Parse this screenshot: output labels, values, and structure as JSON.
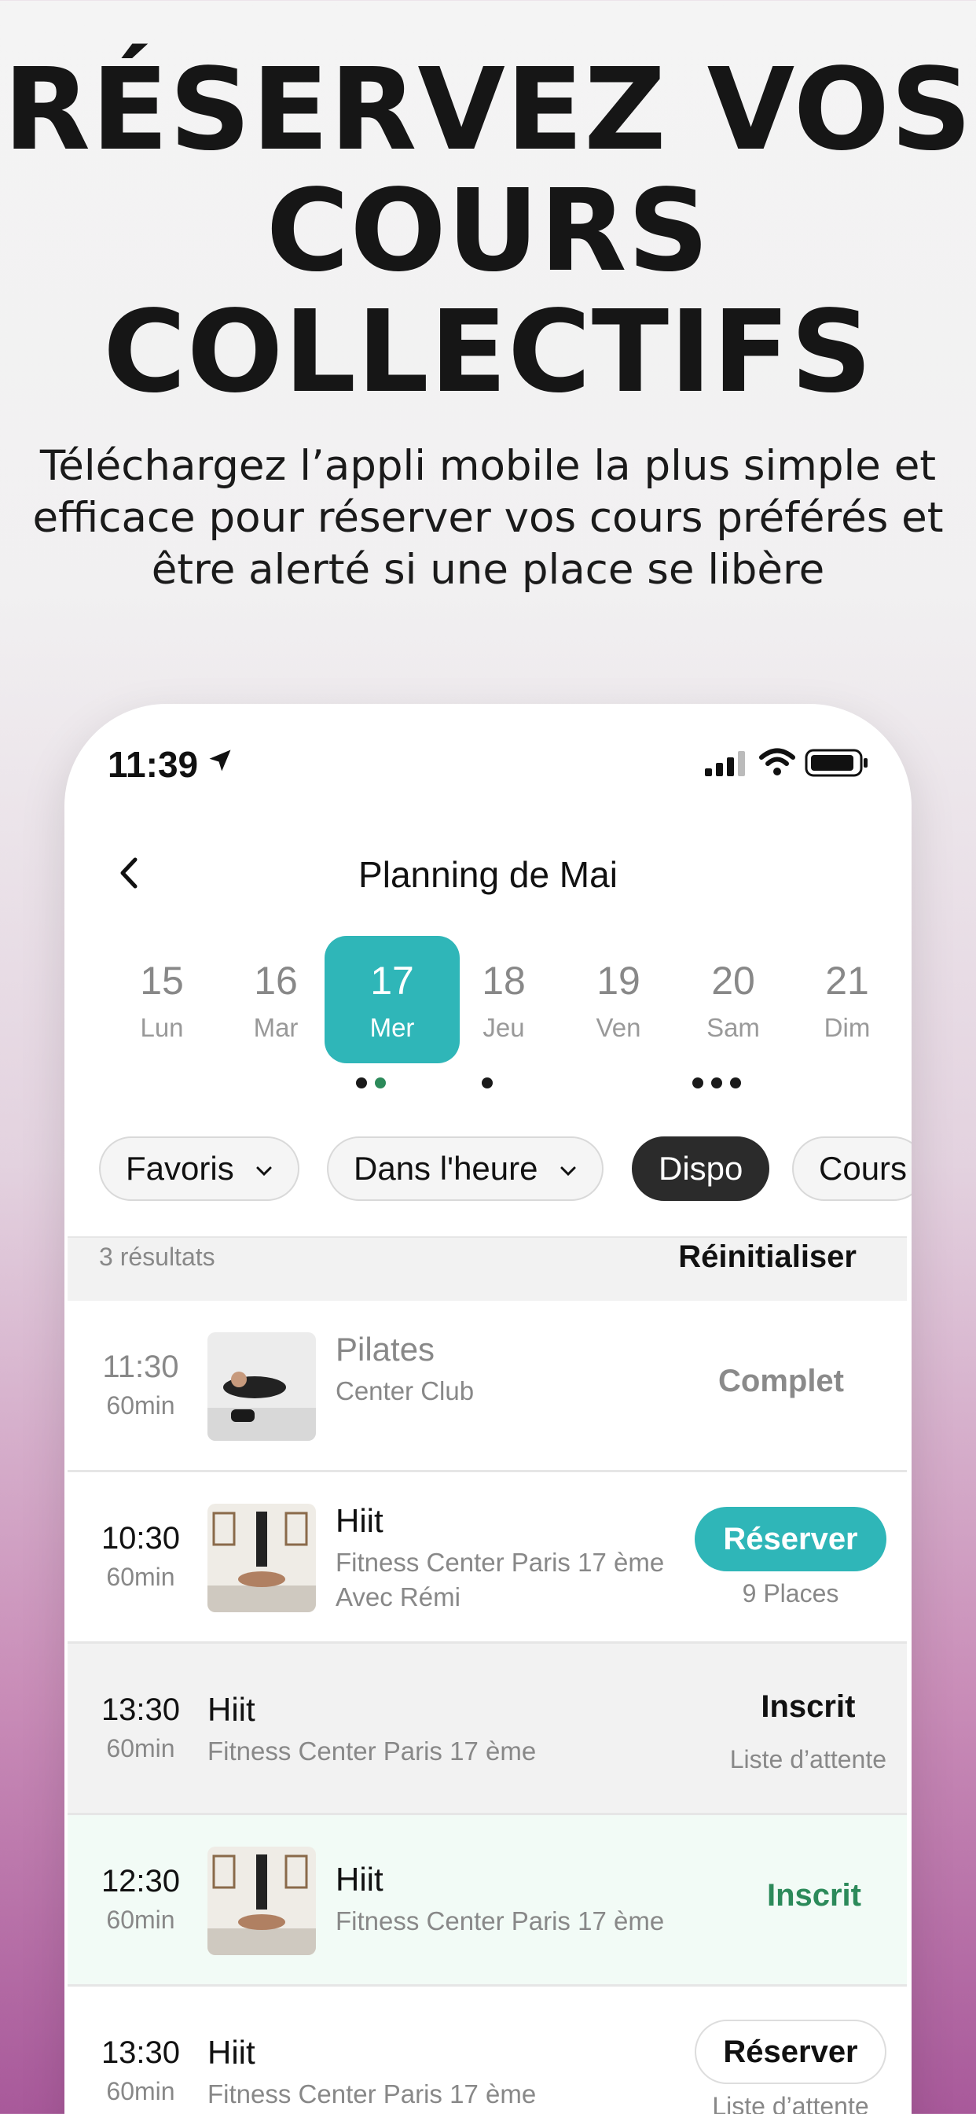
{
  "hero": {
    "title_lines": [
      "RÉSERVEZ VOS",
      "COURS",
      "COLLECTIFS"
    ],
    "subtitle_lines": [
      "Téléchargez l’appli mobile la plus simple et",
      "efficace pour réserver vos cours préférés et",
      "être alerté si une place se libère"
    ]
  },
  "status_bar": {
    "time": "11:39"
  },
  "nav": {
    "title": "Planning de Mai"
  },
  "days": [
    {
      "num": "15",
      "label": "Lun",
      "dots": 0
    },
    {
      "num": "16",
      "label": "Mar",
      "dots": 0
    },
    {
      "num": "17",
      "label": "Mer",
      "dots": 2,
      "active": true
    },
    {
      "num": "18",
      "label": "Jeu",
      "dots": 1
    },
    {
      "num": "19",
      "label": "Ven",
      "dots": 0
    },
    {
      "num": "20",
      "label": "Sam",
      "dots": 3
    },
    {
      "num": "21",
      "label": "Dim",
      "dots": 0
    }
  ],
  "filters": {
    "favoris": "Favoris",
    "dans_heure": "Dans l'heure",
    "dispo": "Dispo",
    "cours": "Cours"
  },
  "results": {
    "count": "3 résultats",
    "reset": "Réinitialiser"
  },
  "classes": [
    {
      "time": "11:30",
      "duration": "60min",
      "name": "Pilates",
      "place": "Center Club",
      "status": "Complet"
    },
    {
      "time": "10:30",
      "duration": "60min",
      "name": "Hiit",
      "place": "Fitness Center Paris 17 ème",
      "coach": "Avec Rémi",
      "button": "Réserver",
      "places": "9 Places"
    },
    {
      "time": "13:30",
      "duration": "60min",
      "name": "Hiit",
      "place": "Fitness Center Paris 17 ème",
      "status": "Inscrit",
      "note": "Liste d’attente"
    },
    {
      "time": "12:30",
      "duration": "60min",
      "name": "Hiit",
      "place": "Fitness Center Paris 17 ème",
      "status": "Inscrit"
    },
    {
      "time": "13:30",
      "duration": "60min",
      "name": "Hiit",
      "place": "Fitness Center Paris 17 ème",
      "button": "Réserver",
      "note": "Liste d’attente"
    }
  ],
  "colors": {
    "accent": "#2fb6b8",
    "inscrit_green": "#2c8a5a",
    "dark_chip": "#2b2b2b"
  }
}
